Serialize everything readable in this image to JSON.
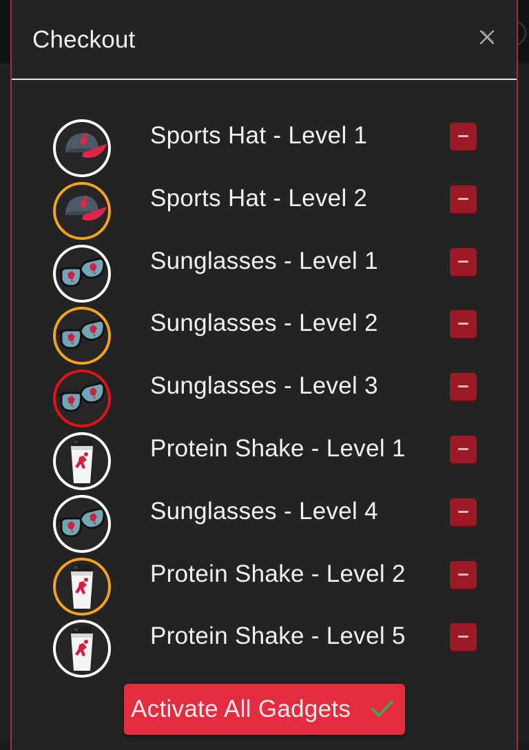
{
  "dialog": {
    "title": "Checkout",
    "close_icon": "close-icon"
  },
  "items": [
    {
      "label": "Sports Hat - Level 1",
      "icon": "sports-hat-icon",
      "ring_color": "#ffffff"
    },
    {
      "label": "Sports Hat - Level 2",
      "icon": "sports-hat-icon",
      "ring_color": "#f5a31a"
    },
    {
      "label": "Sunglasses - Level 1",
      "icon": "sunglasses-icon",
      "ring_color": "#ffffff"
    },
    {
      "label": "Sunglasses - Level 2",
      "icon": "sunglasses-icon",
      "ring_color": "#f5a31a"
    },
    {
      "label": "Sunglasses - Level 3",
      "icon": "sunglasses-icon",
      "ring_color": "#e41313"
    },
    {
      "label": "Protein Shake - Level 1",
      "icon": "protein-shake-icon",
      "ring_color": "#ffffff"
    },
    {
      "label": "Sunglasses - Level 4",
      "icon": "sunglasses-icon",
      "ring_color": "#ffffff"
    },
    {
      "label": "Protein Shake - Level 2",
      "icon": "protein-shake-icon",
      "ring_color": "#f5a31a"
    },
    {
      "label": "Protein Shake - Level 5",
      "icon": "protein-shake-icon",
      "ring_color": "#ffffff"
    }
  ],
  "remove_icon": "minus-icon",
  "activate_button": {
    "label": "Activate All Gadgets",
    "icon": "checkmark-icon"
  },
  "colors": {
    "accent_red": "#e42c40",
    "remove_red": "#9c1a26",
    "level_white": "#ffffff",
    "level_orange": "#f5a31a",
    "level_red": "#e41313",
    "checkmark_green": "#3ea84a"
  }
}
